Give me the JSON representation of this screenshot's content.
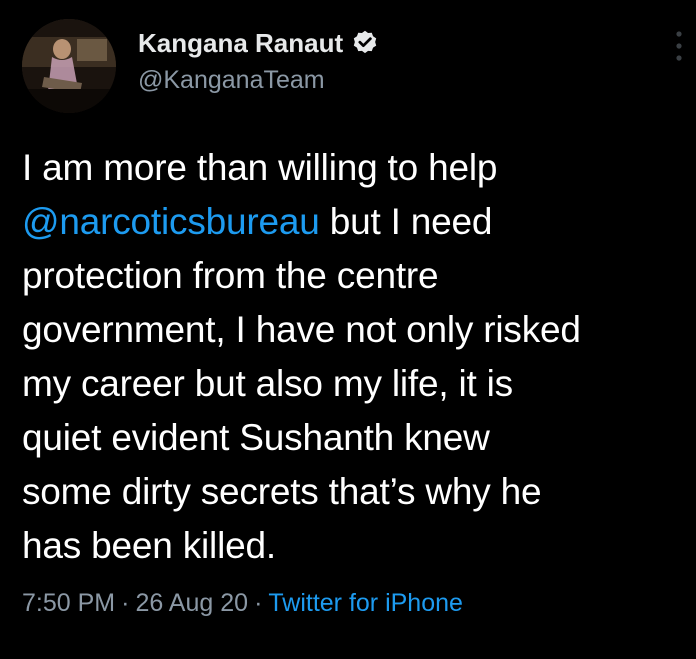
{
  "author": {
    "display_name": "Kangana Ranaut",
    "handle": "@KanganaTeam",
    "verified": true,
    "avatar_icon": "profile-photo"
  },
  "tweet": {
    "lines": [
      [
        {
          "text": "I am more than willing to help",
          "mention": false
        }
      ],
      [
        {
          "text": "@narcoticsbureau",
          "mention": true
        },
        {
          "text": " but I need",
          "mention": false
        }
      ],
      [
        {
          "text": "protection from the centre",
          "mention": false
        }
      ],
      [
        {
          "text": "government, I have not only risked",
          "mention": false
        }
      ],
      [
        {
          "text": "my career but also my life, it is",
          "mention": false
        }
      ],
      [
        {
          "text": "quiet evident Sushanth knew",
          "mention": false
        }
      ],
      [
        {
          "text": "some dirty secrets that’s why he",
          "mention": false
        }
      ],
      [
        {
          "text": "has been killed.",
          "mention": false
        }
      ]
    ]
  },
  "meta": {
    "time": "7:50 PM",
    "separator": "·",
    "date": "26 Aug 20",
    "source": "Twitter for iPhone"
  },
  "colors": {
    "background": "#000000",
    "text": "#ffffff",
    "secondary": "#8b98a5",
    "link": "#1d9bf0"
  },
  "icons": {
    "verified": "verified-badge-icon",
    "more": "more-options-icon"
  }
}
